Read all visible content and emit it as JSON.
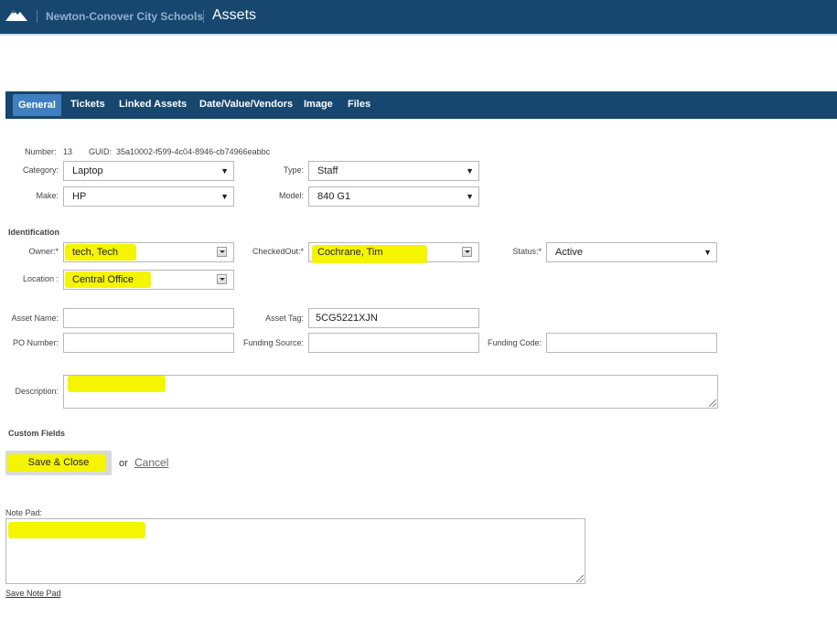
{
  "header": {
    "org_name": "Newton-Conover City Schools",
    "title": "Assets",
    "icon": "mountain-logo-icon"
  },
  "tabs": [
    {
      "label": "General",
      "active": true
    },
    {
      "label": "Tickets",
      "active": false
    },
    {
      "label": "Linked Assets",
      "active": false
    },
    {
      "label": "Date/Value/Vendors",
      "active": false
    },
    {
      "label": "Image",
      "active": false
    },
    {
      "label": "Files",
      "active": false
    }
  ],
  "meta": {
    "number_label": "Number:",
    "number_value": "13",
    "guid_label": "GUID:",
    "guid_value": "35a10002-f599-4c04-8946-cb74966eabbc"
  },
  "fields": {
    "category": {
      "label": "Category:",
      "value": "Laptop"
    },
    "type": {
      "label": "Type:",
      "value": "Staff"
    },
    "make": {
      "label": "Make:",
      "value": "HP"
    },
    "model": {
      "label": "Model:",
      "value": "840 G1"
    },
    "owner": {
      "label": "Owner:*",
      "value": "tech, Tech"
    },
    "checked_out": {
      "label": "CheckedOut:*",
      "value": "Cochrane, Tim"
    },
    "status": {
      "label": "Status:*",
      "value": "Active"
    },
    "location": {
      "label": "Location :",
      "value": "Central Office"
    },
    "asset_name": {
      "label": "Asset Name:",
      "value": ""
    },
    "asset_tag": {
      "label": "Asset Tag:",
      "value": "5CG5221XJN"
    },
    "po_number": {
      "label": "PO Number:",
      "value": ""
    },
    "funding_source": {
      "label": "Funding Source:",
      "value": ""
    },
    "funding_code": {
      "label": "Funding Code:",
      "value": ""
    },
    "description": {
      "label": "Description:",
      "value": ""
    }
  },
  "sections": {
    "identification": "Identification",
    "custom_fields": "Custom Fields"
  },
  "actions": {
    "save_close": "Save & Close",
    "or": "or",
    "cancel": "Cancel"
  },
  "notepad": {
    "label": "Note Pad:",
    "value": "",
    "save_link": "Save Note Pad"
  },
  "colors": {
    "header_bg": "#17466e",
    "active_tab": "#3f7fbf",
    "highlight": "#f5f500"
  }
}
